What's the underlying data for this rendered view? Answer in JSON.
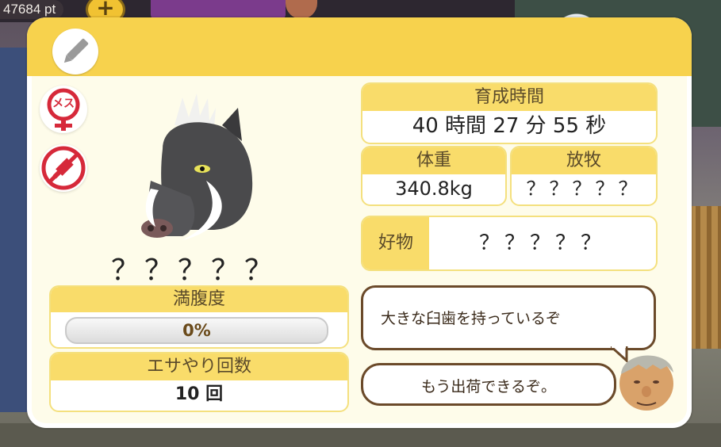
{
  "hud": {
    "points": "47684 pt",
    "add_label": "+"
  },
  "dialog": {
    "gender_label": "メス",
    "name": "？？？？？",
    "stats": {
      "fullness_label": "満腹度",
      "fullness_value": "0%",
      "fullness_fraction": 0,
      "feed_count_label": "エサやり回数",
      "feed_count_value": "10 回",
      "rearing_time_label": "育成時間",
      "rearing_time_value": "40 時間 27 分 55 秒",
      "weight_label": "体重",
      "weight_value": "340.8kg",
      "grazing_label": "放牧",
      "grazing_value": "？？？？？",
      "favorite_food_label": "好物",
      "favorite_food_value": "？？？？？"
    },
    "speech": {
      "line1": "大きな臼歯を持っているぞ",
      "line2": "もう出荷できるぞ。"
    },
    "icons": {
      "edit": "pencil-icon",
      "gender": "female-icon",
      "no_injection": "no-syringe-icon",
      "animal": "boar-icon",
      "npc": "old-farmer-icon"
    },
    "colors": {
      "header": "#f7d24d",
      "panel": "#fefcea",
      "label_bg": "#f9dc6a",
      "gender_red": "#d6293a"
    }
  }
}
